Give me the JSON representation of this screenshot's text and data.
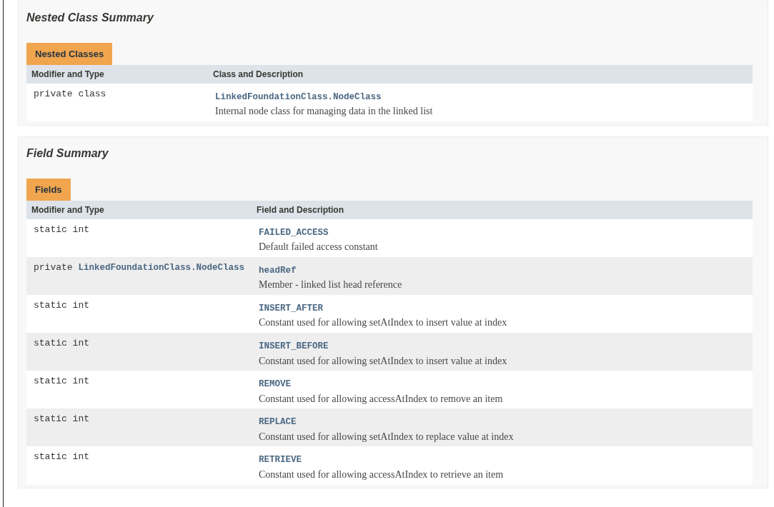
{
  "sections": [
    {
      "title": "Nested Class Summary",
      "caption": "Nested Classes",
      "columns": [
        "Modifier and Type",
        "Class and Description"
      ],
      "rows": [
        {
          "modifier": "private class",
          "name": "LinkedFoundationClass.NodeClass",
          "description": "Internal node class for managing data in the linked list"
        }
      ]
    },
    {
      "title": "Field Summary",
      "caption": "Fields",
      "columns": [
        "Modifier and Type",
        "Field and Description"
      ],
      "rows": [
        {
          "modifier": "static int",
          "name": "FAILED_ACCESS",
          "description": "Default failed access constant"
        },
        {
          "modifier": "private",
          "type_link": "LinkedFoundationClass.NodeClass",
          "name": "headRef",
          "description": "Member - linked list head reference"
        },
        {
          "modifier": "static int",
          "name": "INSERT_AFTER",
          "description": "Constant used for allowing setAtIndex to insert value at index"
        },
        {
          "modifier": "static int",
          "name": "INSERT_BEFORE",
          "description": "Constant used for allowing setAtIndex to insert value at index"
        },
        {
          "modifier": "static int",
          "name": "REMOVE",
          "description": "Constant used for allowing accessAtIndex to remove an item"
        },
        {
          "modifier": "static int",
          "name": "REPLACE",
          "description": "Constant used for allowing setAtIndex to replace value at index"
        },
        {
          "modifier": "static int",
          "name": "RETRIEVE",
          "description": "Constant used for allowing accessAtIndex to retrieve an item"
        }
      ]
    }
  ]
}
